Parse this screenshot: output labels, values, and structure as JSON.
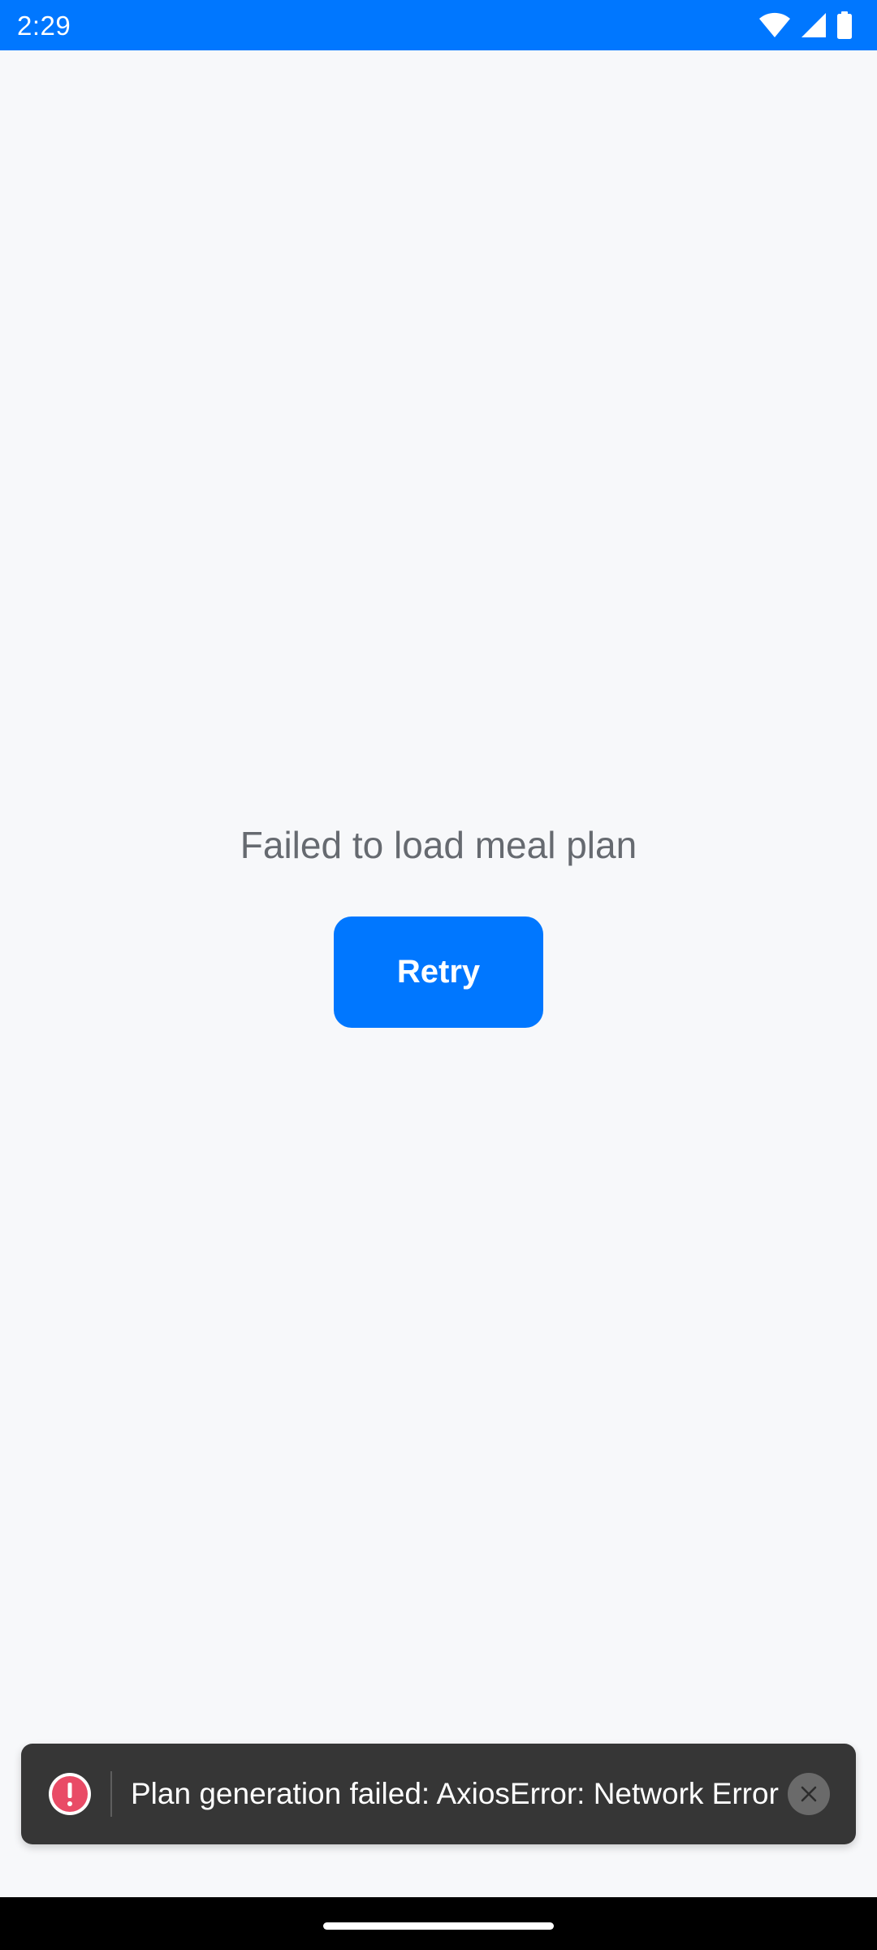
{
  "status_bar": {
    "time": "2:29",
    "icons": [
      "wifi-icon",
      "cellular-signal-icon",
      "battery-icon"
    ],
    "background_color": "#0077ff"
  },
  "main": {
    "error_message": "Failed to load meal plan",
    "retry_label": "Retry",
    "accent_color": "#0077ff"
  },
  "toast": {
    "icon": "error-icon",
    "message": "Plan generation failed: AxiosError: Network Error",
    "close_icon": "close-icon",
    "error_color": "#e94b66"
  }
}
